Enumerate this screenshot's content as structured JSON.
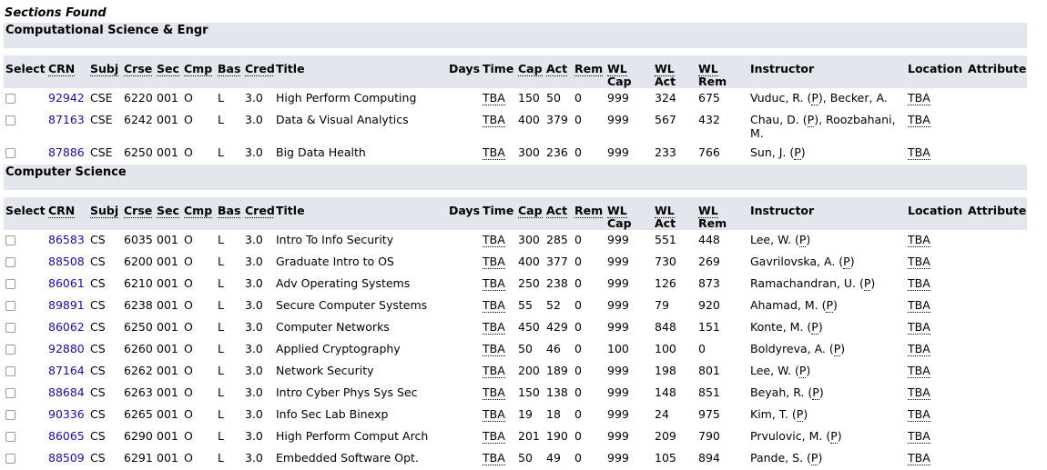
{
  "caption": "Sections Found",
  "headers": {
    "select": "Select",
    "crn": "CRN",
    "subj": "Subj",
    "crse": "Crse",
    "sec": "Sec",
    "cmp": "Cmp",
    "bas": "Bas",
    "cred": "Cred",
    "title": "Title",
    "days": "Days",
    "time": "Time",
    "cap": "Cap",
    "act": "Act",
    "rem": "Rem",
    "wl_cap_1": "WL",
    "wl_cap_2": "Cap",
    "wl_act_1": "WL",
    "wl_act_2": "Act",
    "wl_rem_1": "WL",
    "wl_rem_2": "Rem",
    "instructor": "Instructor",
    "location": "Location",
    "attribute": "Attribute"
  },
  "groups": [
    {
      "subject": "Computational Science & Engr",
      "rows": [
        {
          "crn": "92942",
          "subj": "CSE",
          "crse": "6220",
          "sec": "001",
          "cmp": "O",
          "bas": "L",
          "cred": "3.0",
          "title": "High Perform Computing",
          "time": "TBA",
          "cap": "150",
          "act": "50",
          "rem": "0",
          "wlcap": "999",
          "wlact": "324",
          "wlrem": "675",
          "instr_a": "Vuduc, R. (",
          "instr_p": "P",
          "instr_b": "), Becker, A.",
          "location": "TBA"
        },
        {
          "crn": "87163",
          "subj": "CSE",
          "crse": "6242",
          "sec": "001",
          "cmp": "O",
          "bas": "L",
          "cred": "3.0",
          "title": "Data & Visual Analytics",
          "time": "TBA",
          "cap": "400",
          "act": "379",
          "rem": "0",
          "wlcap": "999",
          "wlact": "567",
          "wlrem": "432",
          "instr_a": "Chau, D. (",
          "instr_p": "P",
          "instr_b": "), Roozbahani, M.",
          "location": "TBA"
        },
        {
          "crn": "87886",
          "subj": "CSE",
          "crse": "6250",
          "sec": "001",
          "cmp": "O",
          "bas": "L",
          "cred": "3.0",
          "title": "Big Data Health",
          "time": "TBA",
          "cap": "300",
          "act": "236",
          "rem": "0",
          "wlcap": "999",
          "wlact": "233",
          "wlrem": "766",
          "instr_a": "Sun, J. (",
          "instr_p": "P",
          "instr_b": ")",
          "location": "TBA"
        }
      ]
    },
    {
      "subject": "Computer Science",
      "rows": [
        {
          "crn": "86583",
          "subj": "CS",
          "crse": "6035",
          "sec": "001",
          "cmp": "O",
          "bas": "L",
          "cred": "3.0",
          "title": "Intro To Info Security",
          "time": "TBA",
          "cap": "300",
          "act": "285",
          "rem": "0",
          "wlcap": "999",
          "wlact": "551",
          "wlrem": "448",
          "instr_a": "Lee, W. (",
          "instr_p": "P",
          "instr_b": ")",
          "location": "TBA"
        },
        {
          "crn": "88508",
          "subj": "CS",
          "crse": "6200",
          "sec": "001",
          "cmp": "O",
          "bas": "L",
          "cred": "3.0",
          "title": "Graduate Intro to OS",
          "time": "TBA",
          "cap": "400",
          "act": "377",
          "rem": "0",
          "wlcap": "999",
          "wlact": "730",
          "wlrem": "269",
          "instr_a": "Gavrilovska, A. (",
          "instr_p": "P",
          "instr_b": ")",
          "location": "TBA"
        },
        {
          "crn": "86061",
          "subj": "CS",
          "crse": "6210",
          "sec": "001",
          "cmp": "O",
          "bas": "L",
          "cred": "3.0",
          "title": "Adv Operating Systems",
          "time": "TBA",
          "cap": "250",
          "act": "238",
          "rem": "0",
          "wlcap": "999",
          "wlact": "126",
          "wlrem": "873",
          "instr_a": "Ramachandran, U. (",
          "instr_p": "P",
          "instr_b": ")",
          "location": "TBA"
        },
        {
          "crn": "89891",
          "subj": "CS",
          "crse": "6238",
          "sec": "001",
          "cmp": "O",
          "bas": "L",
          "cred": "3.0",
          "title": "Secure Computer Systems",
          "time": "TBA",
          "cap": "55",
          "act": "52",
          "rem": "0",
          "wlcap": "999",
          "wlact": "79",
          "wlrem": "920",
          "instr_a": "Ahamad, M. (",
          "instr_p": "P",
          "instr_b": ")",
          "location": "TBA"
        },
        {
          "crn": "86062",
          "subj": "CS",
          "crse": "6250",
          "sec": "001",
          "cmp": "O",
          "bas": "L",
          "cred": "3.0",
          "title": "Computer Networks",
          "time": "TBA",
          "cap": "450",
          "act": "429",
          "rem": "0",
          "wlcap": "999",
          "wlact": "848",
          "wlrem": "151",
          "instr_a": "Konte, M. (",
          "instr_p": "P",
          "instr_b": ")",
          "location": "TBA"
        },
        {
          "crn": "92880",
          "subj": "CS",
          "crse": "6260",
          "sec": "001",
          "cmp": "O",
          "bas": "L",
          "cred": "3.0",
          "title": "Applied Cryptography",
          "time": "TBA",
          "cap": "50",
          "act": "46",
          "rem": "0",
          "wlcap": "100",
          "wlact": "100",
          "wlrem": "0",
          "instr_a": "Boldyreva, A. (",
          "instr_p": "P",
          "instr_b": ")",
          "location": "TBA"
        },
        {
          "crn": "87164",
          "subj": "CS",
          "crse": "6262",
          "sec": "001",
          "cmp": "O",
          "bas": "L",
          "cred": "3.0",
          "title": "Network Security",
          "time": "TBA",
          "cap": "200",
          "act": "189",
          "rem": "0",
          "wlcap": "999",
          "wlact": "198",
          "wlrem": "801",
          "instr_a": "Lee, W. (",
          "instr_p": "P",
          "instr_b": ")",
          "location": "TBA"
        },
        {
          "crn": "88684",
          "subj": "CS",
          "crse": "6263",
          "sec": "001",
          "cmp": "O",
          "bas": "L",
          "cred": "3.0",
          "title": "Intro Cyber Phys Sys Sec",
          "time": "TBA",
          "cap": "150",
          "act": "138",
          "rem": "0",
          "wlcap": "999",
          "wlact": "148",
          "wlrem": "851",
          "instr_a": "Beyah, R. (",
          "instr_p": "P",
          "instr_b": ")",
          "location": "TBA"
        },
        {
          "crn": "90336",
          "subj": "CS",
          "crse": "6265",
          "sec": "001",
          "cmp": "O",
          "bas": "L",
          "cred": "3.0",
          "title": "Info Sec Lab Binexp",
          "time": "TBA",
          "cap": "19",
          "act": "18",
          "rem": "0",
          "wlcap": "999",
          "wlact": "24",
          "wlrem": "975",
          "instr_a": "Kim, T. (",
          "instr_p": "P",
          "instr_b": ")",
          "location": "TBA"
        },
        {
          "crn": "86065",
          "subj": "CS",
          "crse": "6290",
          "sec": "001",
          "cmp": "O",
          "bas": "L",
          "cred": "3.0",
          "title": "High Perform Comput Arch",
          "time": "TBA",
          "cap": "201",
          "act": "190",
          "rem": "0",
          "wlcap": "999",
          "wlact": "209",
          "wlrem": "790",
          "instr_a": "Prvulovic, M. (",
          "instr_p": "P",
          "instr_b": ")",
          "location": "TBA"
        },
        {
          "crn": "88509",
          "subj": "CS",
          "crse": "6291",
          "sec": "001",
          "cmp": "O",
          "bas": "L",
          "cred": "3.0",
          "title": "Embedded Software Opt.",
          "time": "TBA",
          "cap": "50",
          "act": "49",
          "rem": "0",
          "wlcap": "999",
          "wlact": "105",
          "wlrem": "894",
          "instr_a": "Pande, S. (",
          "instr_p": "P",
          "instr_b": ")",
          "location": "TBA"
        }
      ]
    }
  ]
}
